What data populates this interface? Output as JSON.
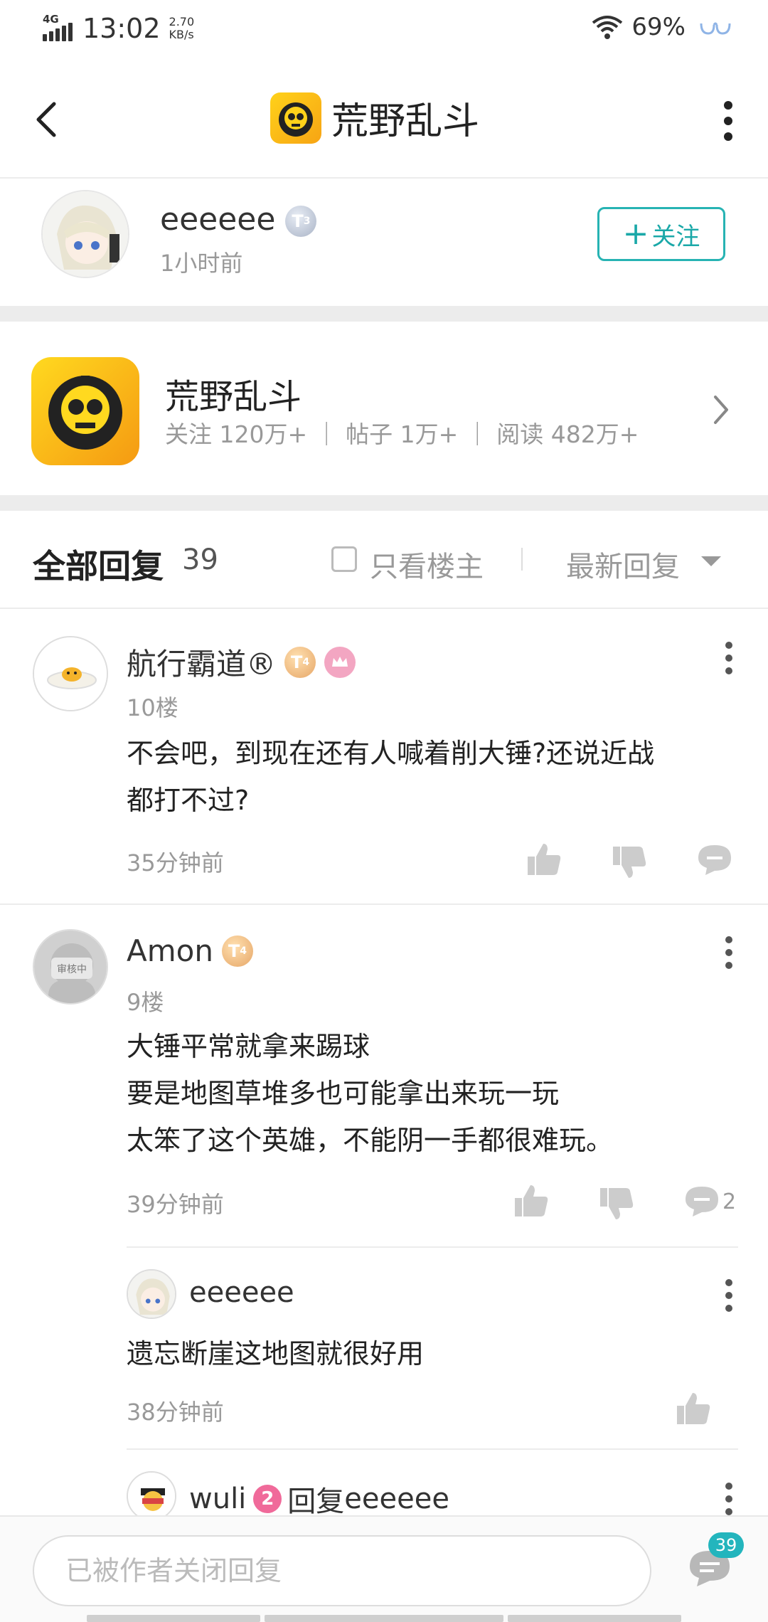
{
  "status_bar": {
    "network": "4G",
    "time": "13:02",
    "speed_value": "2.70",
    "speed_unit": "KB/s",
    "battery": "69%"
  },
  "header": {
    "title": "荒野乱斗"
  },
  "post_author": {
    "name": "eeeeee",
    "level_badge": "T3",
    "time": "1小时前",
    "follow_label": "关注"
  },
  "forum": {
    "name": "荒野乱斗",
    "stats": "关注 120万+ ｜ 帖子 1万+ ｜ 阅读 482万+"
  },
  "replies_header": {
    "title": "全部回复",
    "count": "39",
    "only_op_label": "只看楼主",
    "sort_label": "最新回复"
  },
  "comments": [
    {
      "name": "航行霸道®",
      "badge": "T4",
      "floor": "10楼",
      "text_lines": [
        "不会吧，到现在还有人喊着削大锤?还说近战",
        "都打不过?"
      ],
      "time": "35分钟前",
      "reply_count": ""
    },
    {
      "name": "Amon",
      "badge": "T4",
      "floor": "9楼",
      "avatar_text": "审核中",
      "text_lines": [
        "大锤平常就拿来踢球",
        "要是地图草堆多也可能拿出来玩一玩",
        "太笨了这个英雄，不能阴一手都很难玩。"
      ],
      "time": "39分钟前",
      "reply_count": "2"
    }
  ],
  "sub_replies": [
    {
      "name": "eeeeee",
      "text": "遗忘断崖这地图就很好用",
      "time": "38分钟前"
    },
    {
      "name": "wuli",
      "level": "2",
      "reply_prefix": "回复",
      "reply_to": "eeeeee"
    }
  ],
  "bottom_bar": {
    "input_placeholder": "已被作者关闭回复",
    "comment_count": "39"
  },
  "colors": {
    "accent": "#27b3b3",
    "gold": "#f7a414",
    "badge_pink": "#f06a9a"
  }
}
